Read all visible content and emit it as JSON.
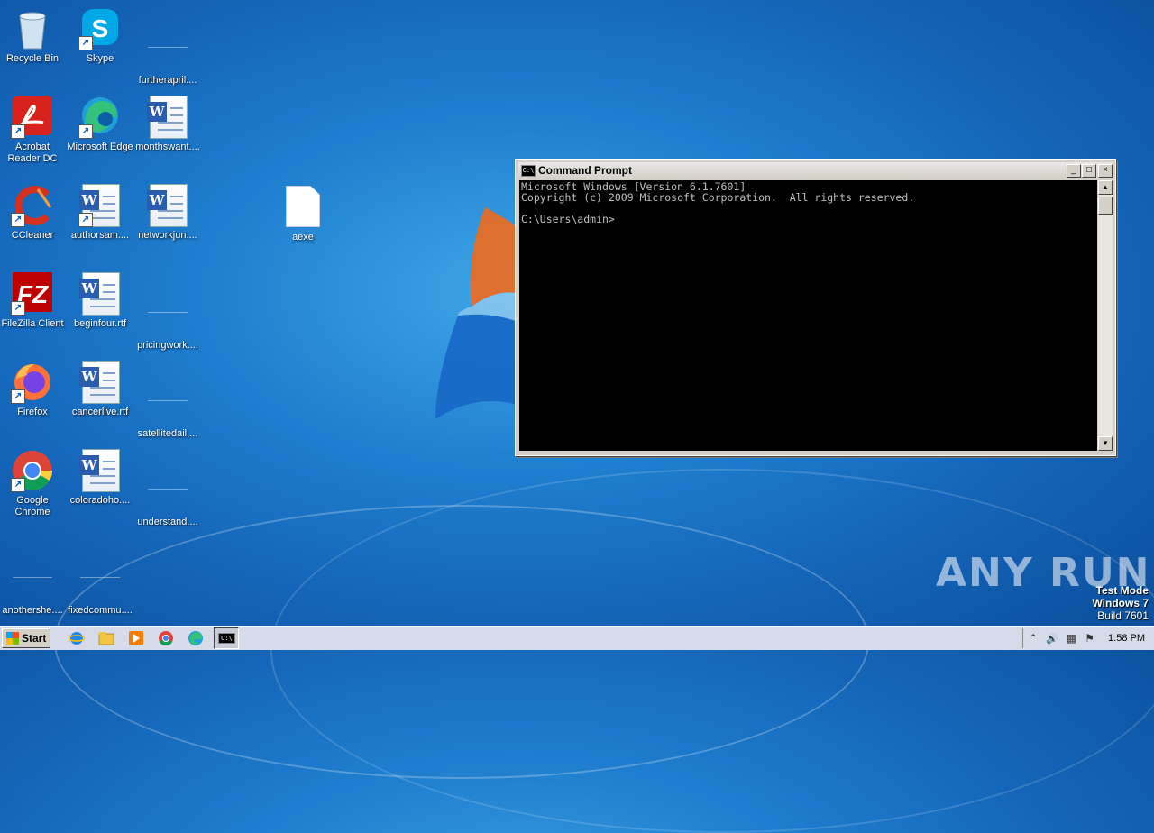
{
  "desktop": {
    "icons": [
      {
        "label": "Recycle Bin",
        "icon": "recycle-bin-icon"
      },
      {
        "label": "Skype",
        "icon": "skype-icon"
      },
      {
        "label": "furtherapril....",
        "icon": "document-icon"
      },
      {
        "label": "Acrobat Reader DC",
        "icon": "acrobat-icon"
      },
      {
        "label": "Microsoft Edge",
        "icon": "edge-icon"
      },
      {
        "label": "monthswant....",
        "icon": "word-doc-icon"
      },
      {
        "label": "CCleaner",
        "icon": "ccleaner-icon"
      },
      {
        "label": "authorsam....",
        "icon": "word-doc-icon"
      },
      {
        "label": "networkjun....",
        "icon": "word-doc-icon"
      },
      {
        "label": "aexe",
        "icon": "blank-file-icon"
      },
      {
        "label": "FileZilla Client",
        "icon": "filezilla-icon"
      },
      {
        "label": "beginfour.rtf",
        "icon": "word-doc-icon"
      },
      {
        "label": "pricingwork....",
        "icon": "document-icon"
      },
      {
        "label": "Firefox",
        "icon": "firefox-icon"
      },
      {
        "label": "cancerlive.rtf",
        "icon": "word-doc-icon"
      },
      {
        "label": "satellitedail....",
        "icon": "document-icon"
      },
      {
        "label": "Google Chrome",
        "icon": "chrome-icon"
      },
      {
        "label": "coloradoho....",
        "icon": "word-doc-icon"
      },
      {
        "label": "understand....",
        "icon": "document-icon"
      },
      {
        "label": "anothershe....",
        "icon": "document-icon"
      },
      {
        "label": "fixedcommu....",
        "icon": "document-icon"
      }
    ],
    "watermark": "ANY RUN",
    "test_mode": {
      "line1": "Test Mode",
      "line2": "Windows 7",
      "line3": "Build 7601"
    }
  },
  "cmd_window": {
    "title": "Command Prompt",
    "title_icon_text": "C:\\",
    "buttons": {
      "minimize": "_",
      "maximize": "□",
      "close": "×"
    },
    "lines": [
      "Microsoft Windows [Version 6.1.7601]",
      "Copyright (c) 2009 Microsoft Corporation.  All rights reserved.",
      "",
      "C:\\Users\\admin>"
    ]
  },
  "taskbar": {
    "start_label": "Start",
    "apps": [
      {
        "name": "internet-explorer-icon",
        "glyph": "e"
      },
      {
        "name": "file-explorer-icon",
        "glyph": "▤"
      },
      {
        "name": "media-player-icon",
        "glyph": "▶"
      },
      {
        "name": "chrome-icon",
        "glyph": "●"
      },
      {
        "name": "edge-icon",
        "glyph": "◐"
      },
      {
        "name": "cmd-icon",
        "glyph": "C:\\"
      }
    ],
    "tray": {
      "chevron": "⌃",
      "volume": "🔊",
      "network": "▦",
      "flag": "⚑"
    },
    "clock": "1:58 PM"
  },
  "colors": {
    "desktop": "#1f7fd0",
    "console_bg": "#000000",
    "console_fg": "#c0c0c0"
  }
}
